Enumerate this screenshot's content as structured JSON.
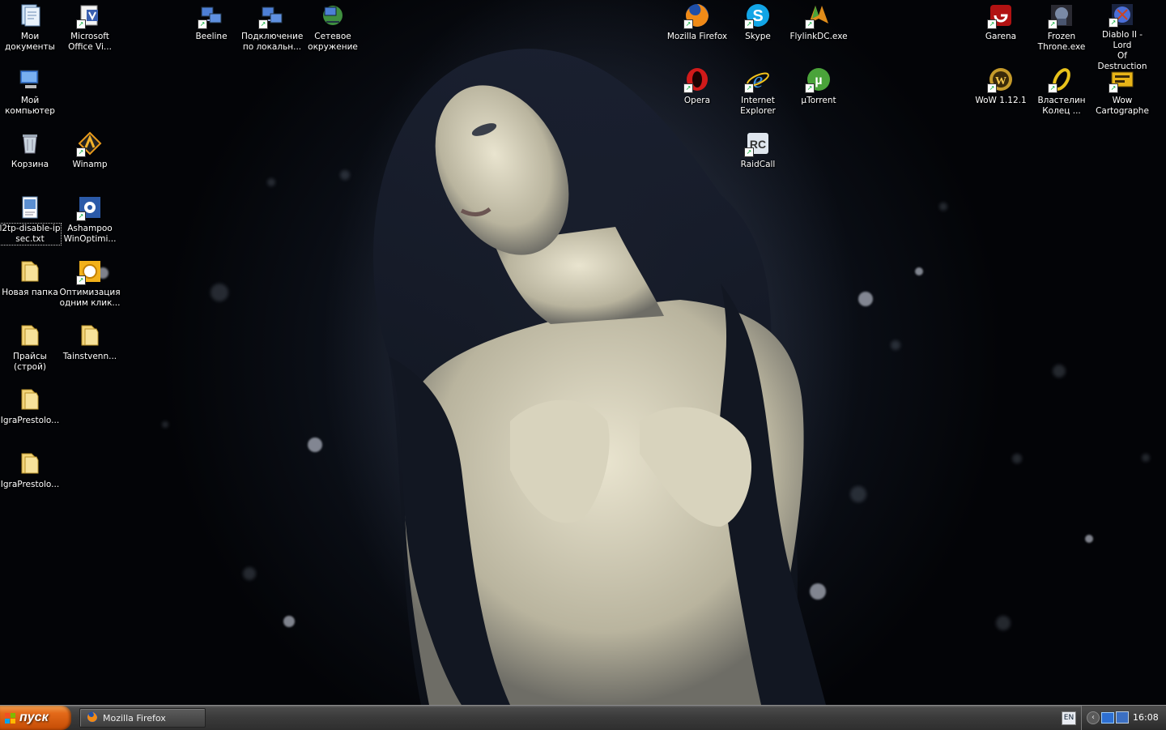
{
  "desktop": {
    "icons": [
      {
        "label": "Мои\nдокументы",
        "icon": "my-documents-icon",
        "name": "icon-my-documents"
      },
      {
        "label": "Microsoft\nOffice Vi...",
        "icon": "ms-office-visio-icon",
        "name": "icon-ms-office"
      },
      {
        "label": "Beeline",
        "icon": "network-connection-icon",
        "name": "icon-beeline"
      },
      {
        "label": "Подключение\nпо локальн...",
        "icon": "local-connection-icon",
        "name": "icon-local-connection"
      },
      {
        "label": "Сетевое\nокружение",
        "icon": "network-places-icon",
        "name": "icon-network-places"
      },
      {
        "label": "Mozilla Firefox",
        "icon": "firefox-icon",
        "name": "icon-firefox"
      },
      {
        "label": "Skype",
        "icon": "skype-icon",
        "name": "icon-skype"
      },
      {
        "label": "FlylinkDC.exe",
        "icon": "flylinkdc-icon",
        "name": "icon-flylinkdc"
      },
      {
        "label": "Garena",
        "icon": "garena-icon",
        "name": "icon-garena"
      },
      {
        "label": "Frozen\nThrone.exe",
        "icon": "frozen-throne-icon",
        "name": "icon-frozen-throne"
      },
      {
        "label": "Diablo II - Lord\nOf Destruction",
        "icon": "diablo-icon",
        "name": "icon-diablo"
      },
      {
        "label": "Мой\nкомпьютер",
        "icon": "my-computer-icon",
        "name": "icon-my-computer"
      },
      {
        "label": "Opera",
        "icon": "opera-icon",
        "name": "icon-opera"
      },
      {
        "label": "Internet\nExplorer",
        "icon": "internet-explorer-icon",
        "name": "icon-internet-explorer"
      },
      {
        "label": "µTorrent",
        "icon": "utorrent-icon",
        "name": "icon-utorrent"
      },
      {
        "label": "WoW 1.12.1",
        "icon": "wow-icon",
        "name": "icon-wow"
      },
      {
        "label": "Властелин\nКолец ...",
        "icon": "lotr-ring-icon",
        "name": "icon-lotr"
      },
      {
        "label": "Wow\nCartographe",
        "icon": "wow-cartographer-icon",
        "name": "icon-wow-cartographer"
      },
      {
        "label": "Корзина",
        "icon": "recycle-bin-icon",
        "name": "icon-recycle-bin"
      },
      {
        "label": "Winamp",
        "icon": "winamp-icon",
        "name": "icon-winamp"
      },
      {
        "label": "RaidCall",
        "icon": "raidcall-icon",
        "name": "icon-raidcall"
      },
      {
        "label": "l2tp-disable-ip\nsec.txt",
        "icon": "text-file-icon",
        "name": "icon-l2tp-txt"
      },
      {
        "label": "Ashampoo\nWinOptimi...",
        "icon": "ashampoo-icon",
        "name": "icon-ashampoo"
      },
      {
        "label": "Новая папка",
        "icon": "folder-icon",
        "name": "icon-new-folder"
      },
      {
        "label": "Оптимизация\nодним клик...",
        "icon": "optimization-icon",
        "name": "icon-optimization"
      },
      {
        "label": "Прайсы\n(строй)",
        "icon": "folder-icon",
        "name": "icon-folder-prices"
      },
      {
        "label": "Tainstvenn...",
        "icon": "folder-icon",
        "name": "icon-folder-tainstvenn"
      },
      {
        "label": "IgraPrestolo...",
        "icon": "folder-icon",
        "name": "icon-folder-igra-1"
      },
      {
        "label": "IgraPrestolo...",
        "icon": "folder-icon",
        "name": "icon-folder-igra-2"
      }
    ]
  },
  "taskbar": {
    "start_label": "пуск",
    "tasks": [
      {
        "label": "Mozilla Firefox",
        "icon": "firefox-icon"
      }
    ],
    "language": "EN",
    "clock": "16:08",
    "tray_icons": [
      "chevron-left-icon",
      "network-icon",
      "monitor-icon"
    ]
  },
  "colors": {
    "taskbar": "#3a3a3a",
    "start": "#e46a1a",
    "desktop": "#05070c"
  }
}
